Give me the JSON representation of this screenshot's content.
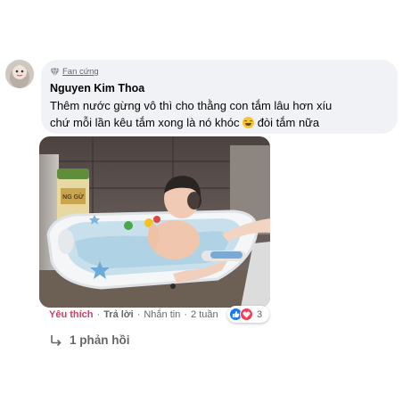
{
  "comment": {
    "badge_label": "Fan cứng",
    "author": "Nguyen Kim Thoa",
    "text_line1": "Thêm nước gừng vô thì cho thằng con tắm lâu hơn xíu",
    "text_line2_before_emoji": "chứ mỗi lần kêu tắm xong là nó khóc ",
    "text_line2_after_emoji": " đòi tắm nữa",
    "emoji": "grinning-face-emoji"
  },
  "photo": {
    "icon": "photo-baby-bathtub",
    "package_text": "NG GỪ"
  },
  "actions": {
    "like_label": "Yêu thích",
    "reply_label": "Trả lời",
    "message_label": "Nhắn tin",
    "separator": "·",
    "timestamp": "2 tuần"
  },
  "reactions": {
    "count": "3",
    "icons": [
      "like-reaction-icon",
      "love-reaction-icon"
    ]
  },
  "replies": {
    "label": "1 phản hồi",
    "icon": "reply-arrow-icon"
  },
  "colors": {
    "bubble": "#f0f2f5",
    "like_action": "#d33d5f",
    "muted_text": "#65676b",
    "like_reaction": "#1877f2",
    "love_reaction": "#f33e58"
  }
}
